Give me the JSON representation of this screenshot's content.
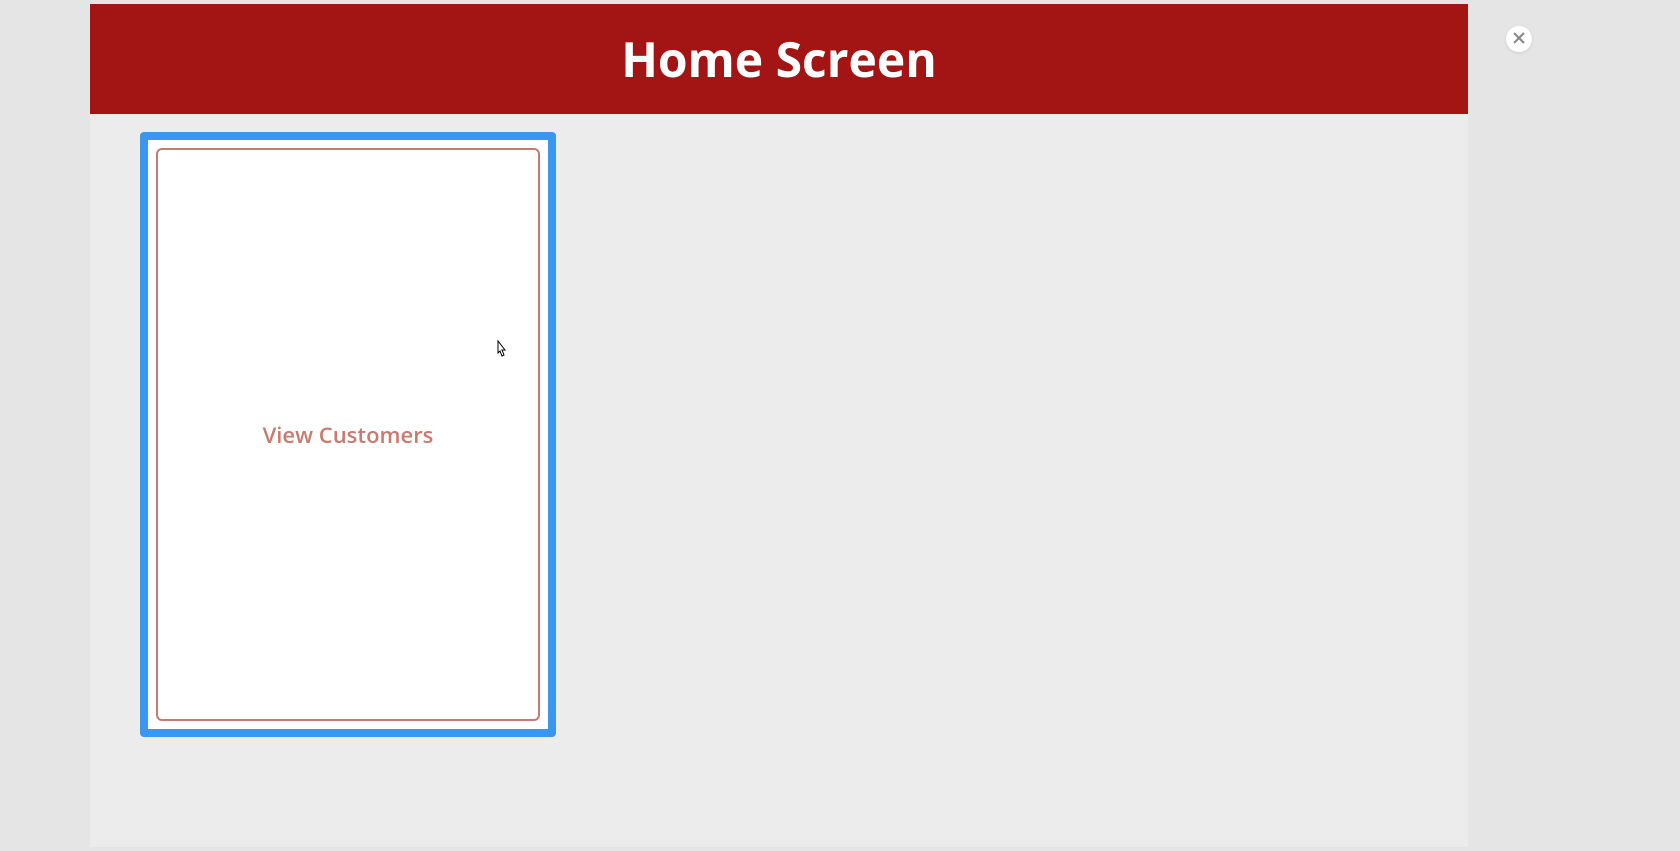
{
  "header": {
    "title": "Home Screen"
  },
  "cards": [
    {
      "label": "View Customers"
    }
  ],
  "colors": {
    "header_bg": "#a31515",
    "card_border": "#3a97f0",
    "card_inner_border": "#c77a6f",
    "card_text": "#c77a6f"
  }
}
